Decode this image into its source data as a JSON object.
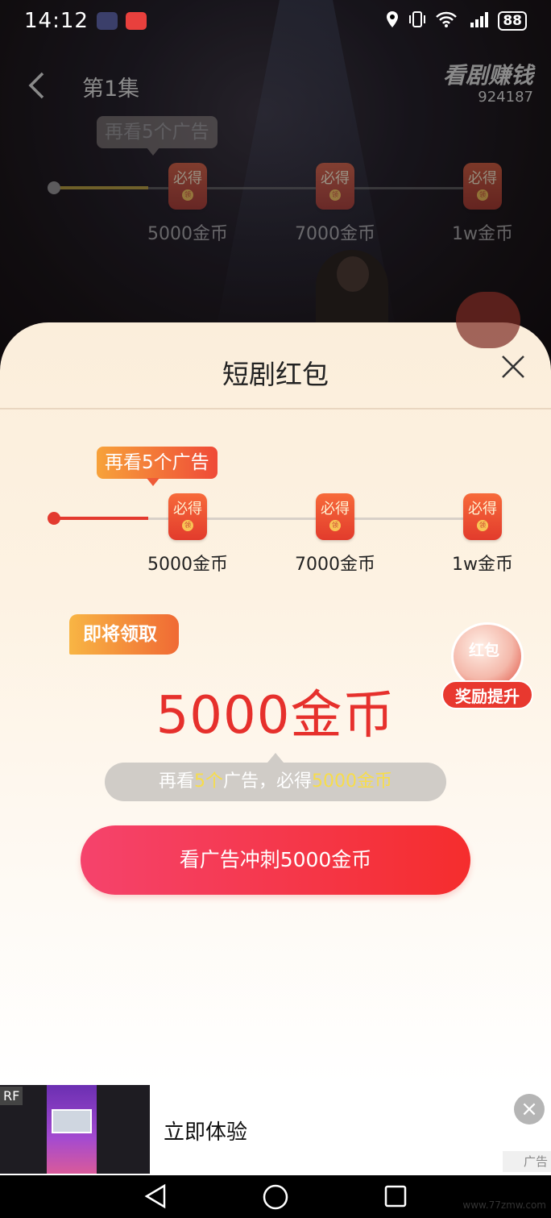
{
  "status_bar": {
    "time": "14:12",
    "battery": "88"
  },
  "header": {
    "episode": "第1集",
    "brand": "看剧赚钱",
    "brand_id": "924187"
  },
  "progress": {
    "bubble": "再看5个广告",
    "nodes": [
      {
        "badge": "必得",
        "seal": "领",
        "label": "5000金币"
      },
      {
        "badge": "必得",
        "seal": "领",
        "label": "7000金币"
      },
      {
        "badge": "必得",
        "seal": "领",
        "label": "1w金币"
      }
    ]
  },
  "sheet": {
    "title": "短剧红包",
    "soon_tag": "即将领取",
    "amount": "5000金币",
    "boost": {
      "ball_label": "红包",
      "badge": "奖励提升"
    },
    "hint": {
      "pre": "再看",
      "count": "5个",
      "mid": "广告，必得",
      "reward": "5000金币"
    },
    "cta": "看广告冲刺5000金币"
  },
  "ad": {
    "rf": "RF",
    "cta_text": "立即体验",
    "label": "广告"
  },
  "watermark": "www.77zmw.com"
}
